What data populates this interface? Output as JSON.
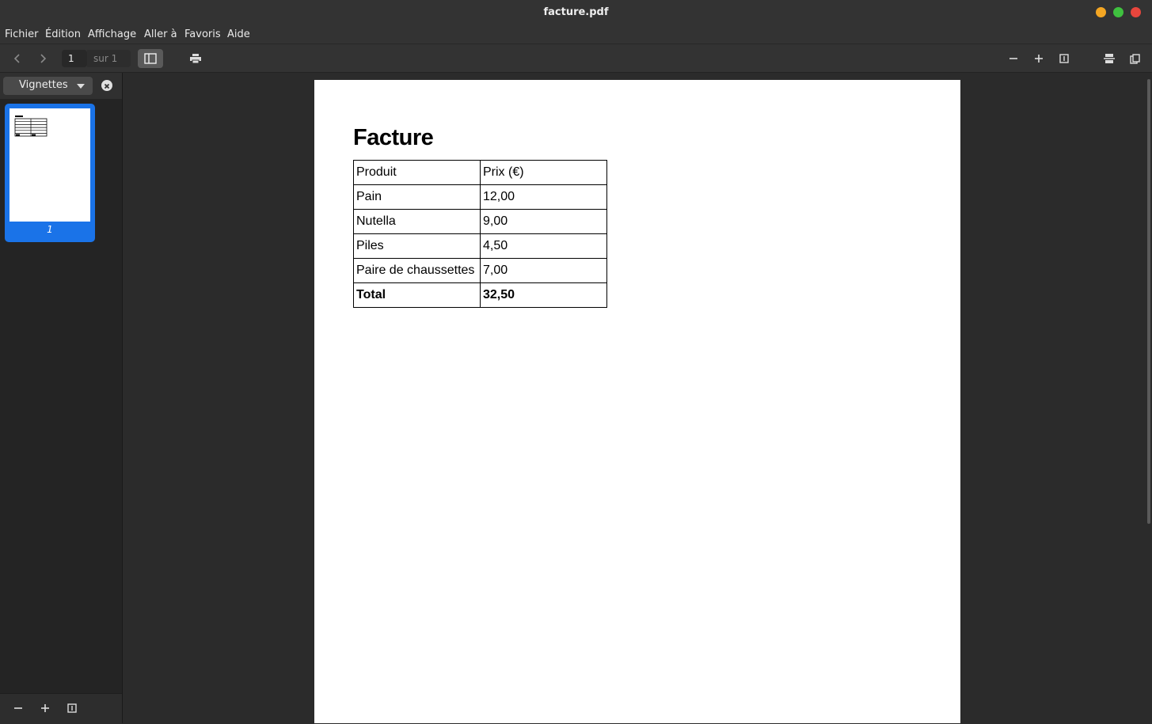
{
  "window": {
    "title": "facture.pdf",
    "controls": {
      "minimize_color": "#f4a623",
      "maximize_color": "#3fc13f",
      "close_color": "#e8463d"
    }
  },
  "menubar": {
    "items": [
      "Fichier",
      "Édition",
      "Affichage",
      "Aller à",
      "Favoris",
      "Aide"
    ]
  },
  "toolbar": {
    "page_current": "1",
    "page_total": "sur 1",
    "icons": [
      "chevron-left-icon",
      "chevron-right-icon",
      "sidebar-toggle-icon",
      "print-icon",
      "zoom-out-icon",
      "zoom-in-icon",
      "fit-page-icon",
      "annotate-icon",
      "copy-icon"
    ]
  },
  "sidebar": {
    "dropdown_label": "Vignettes",
    "thumbnail_label": "1",
    "accent_color": "#1a73e8"
  },
  "document": {
    "title": "Facture",
    "headers": [
      "Produit",
      "Prix (€)"
    ],
    "rows": [
      [
        "Pain",
        "12,00"
      ],
      [
        "Nutella",
        "9,00"
      ],
      [
        "Piles",
        "4,50"
      ],
      [
        "Paire de chaussettes",
        "7,00"
      ]
    ],
    "total": [
      "Total",
      "32,50"
    ]
  }
}
